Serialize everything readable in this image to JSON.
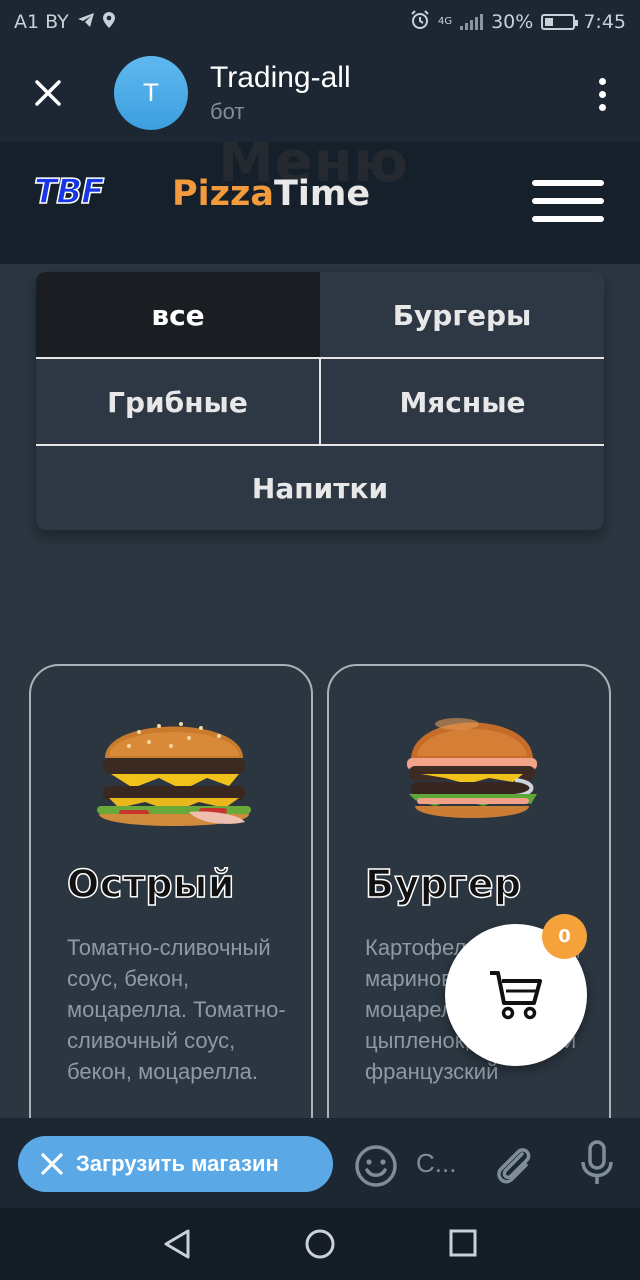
{
  "status_bar": {
    "carrier": "A1 BY",
    "battery": "30%",
    "battery_level": 0.3,
    "network": "4G",
    "time": "7:45"
  },
  "chat": {
    "avatar_letter": "T",
    "bot_name": "Trading-all",
    "subtitle": "бот"
  },
  "site": {
    "watermark": "Меню",
    "tbf_logo": "TBF",
    "logo_part1": "Pizza",
    "logo_part2": "Time",
    "brand_color": "#f39a3c"
  },
  "categories": {
    "all": "все",
    "burgers": "Бургеры",
    "mushroom": "Грибные",
    "meat": "Мясные",
    "drinks": "Напитки",
    "active": "все"
  },
  "products": [
    {
      "title": "Острый",
      "description": "Томатно-сливочный соус, бекон, моцарелла. Томатно-сливочный соус, бекон, моцарелла."
    },
    {
      "title": "Бургер",
      "description": "Картофель, морковь, маринов..., моцарелла, цыпленок, ветчина и французский"
    }
  ],
  "cart": {
    "count": "0",
    "badge_color": "#f6a23b"
  },
  "input_bar": {
    "load_button": "Загрузить магазин",
    "placeholder": "С..."
  }
}
